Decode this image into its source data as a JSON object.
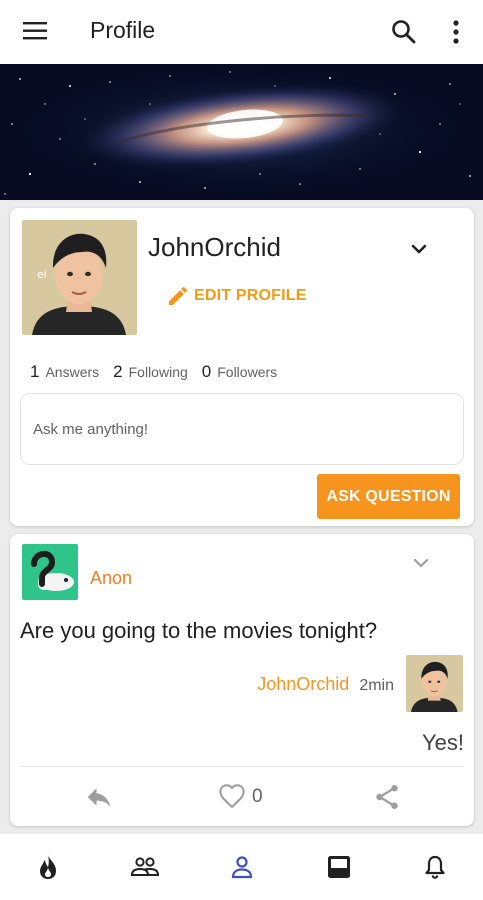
{
  "appbar": {
    "title": "Profile",
    "menu_icon": "menu-icon",
    "search_icon": "search-icon",
    "more_icon": "more-vert-icon"
  },
  "profile": {
    "username": "JohnOrchid",
    "edit_label": "EDIT PROFILE",
    "stats": [
      {
        "count": "1",
        "label": "Answers"
      },
      {
        "count": "2",
        "label": "Following"
      },
      {
        "count": "0",
        "label": "Followers"
      }
    ],
    "ask_placeholder": "Ask me anything!",
    "ask_button": "ASK QUESTION"
  },
  "question": {
    "asker": "Anon",
    "text": "Are you going to the movies tonight?",
    "answerer": "JohnOrchid",
    "time": "2min",
    "answer": "Yes!",
    "likes": "0"
  },
  "bottom_nav": [
    {
      "icon": "fire-icon",
      "active": false
    },
    {
      "icon": "people-icon",
      "active": false
    },
    {
      "icon": "person-icon",
      "active": true
    },
    {
      "icon": "inbox-icon",
      "active": false
    },
    {
      "icon": "bell-icon",
      "active": false
    }
  ],
  "colors": {
    "accent": "#f7941d",
    "anon_accent": "#f47e1f",
    "active_nav": "#3d4fc4",
    "anon_avatar_bg": "#2ec48b"
  }
}
